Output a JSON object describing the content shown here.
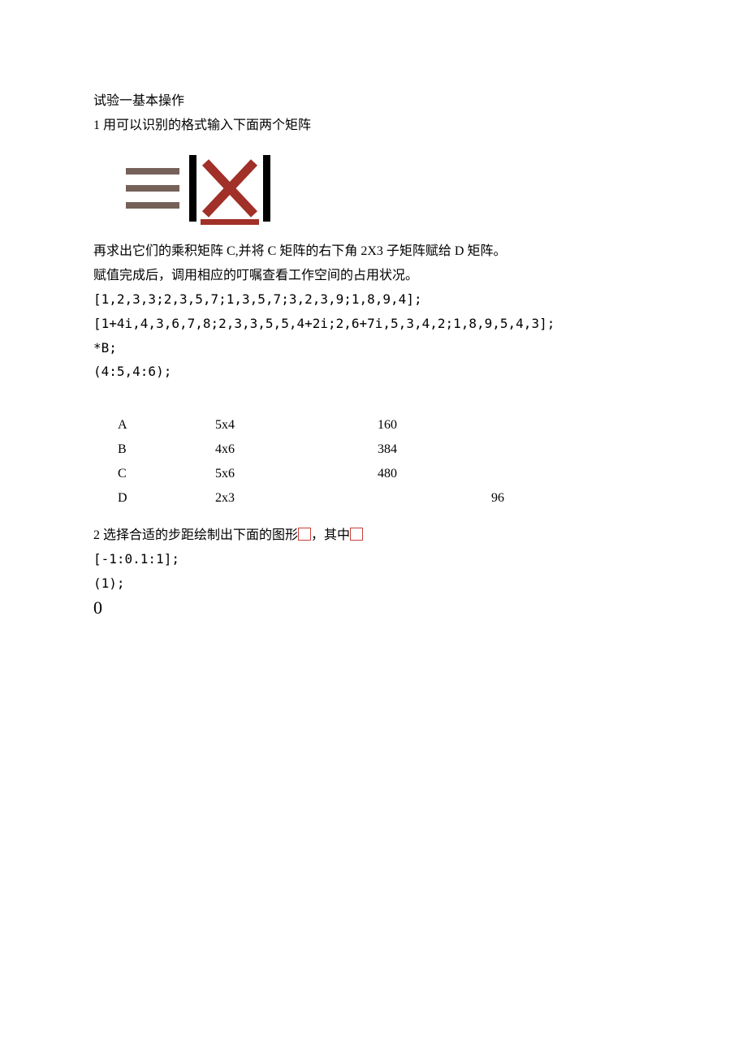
{
  "title": "试验一基本操作",
  "q1_heading": "1 用可以识别的格式输入下面两个矩阵",
  "para1": "再求出它们的乘积矩阵 C,并将 C 矩阵的右下角 2X3 子矩阵赋给 D 矩阵。",
  "para2": "赋值完成后，调用相应的叮嘱查看工作空间的占用状况。",
  "code1": "[1,2,3,3;2,3,5,7;1,3,5,7;3,2,3,9;1,8,9,4];",
  "code2": "[1+4i,4,3,6,7,8;2,3,3,5,5,4+2i;2,6+7i,5,3,4,2;1,8,9,5,4,3];",
  "code3": "*B;",
  "code4": "(4:5,4:6);",
  "ws_rows": [
    {
      "name": "A",
      "size": "5x4",
      "bytes": "160",
      "extra": ""
    },
    {
      "name": "B",
      "size": "4x6",
      "bytes": "384",
      "extra": ""
    },
    {
      "name": "C",
      "size": "5x6",
      "bytes": "480",
      "extra": ""
    },
    {
      "name": "D",
      "size": "2x3",
      "bytes": "",
      "extra": "96"
    }
  ],
  "q2_prefix": "2 选择合适的步距绘制出下面的图形",
  "q2_mid": "，其中",
  "code5": "[-1:0.1:1];",
  "code6": "(1);",
  "zero": "0"
}
